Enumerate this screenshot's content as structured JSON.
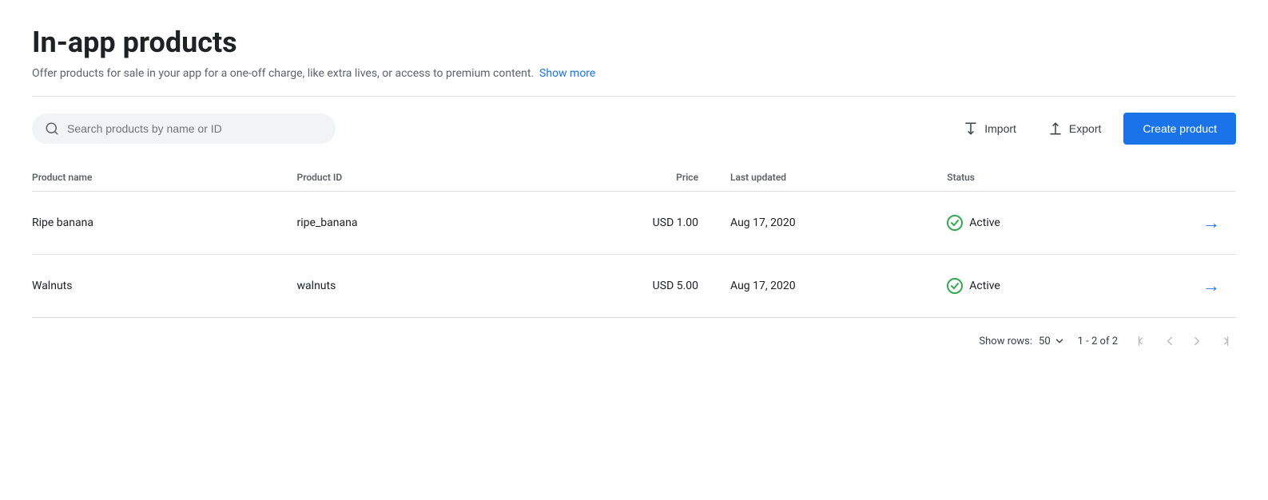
{
  "page": {
    "title": "In-app products",
    "subtitle": "Offer products for sale in your app for a one-off charge, like extra lives, or access to premium content.",
    "show_more_label": "Show more"
  },
  "toolbar": {
    "search_placeholder": "Search products by name or ID",
    "import_label": "Import",
    "export_label": "Export",
    "create_label": "Create product"
  },
  "table": {
    "columns": [
      {
        "key": "product_name",
        "label": "Product name"
      },
      {
        "key": "product_id",
        "label": "Product ID"
      },
      {
        "key": "price",
        "label": "Price"
      },
      {
        "key": "last_updated",
        "label": "Last updated"
      },
      {
        "key": "status",
        "label": "Status"
      }
    ],
    "rows": [
      {
        "product_name": "Ripe banana",
        "product_id": "ripe_banana",
        "price": "USD 1.00",
        "last_updated": "Aug 17, 2020",
        "status": "Active"
      },
      {
        "product_name": "Walnuts",
        "product_id": "walnuts",
        "price": "USD 5.00",
        "last_updated": "Aug 17, 2020",
        "status": "Active"
      }
    ]
  },
  "pagination": {
    "show_rows_label": "Show rows:",
    "rows_per_page": "50",
    "page_info": "1 - 2 of 2"
  },
  "colors": {
    "accent_blue": "#1a73e8",
    "active_green": "#34a853"
  }
}
